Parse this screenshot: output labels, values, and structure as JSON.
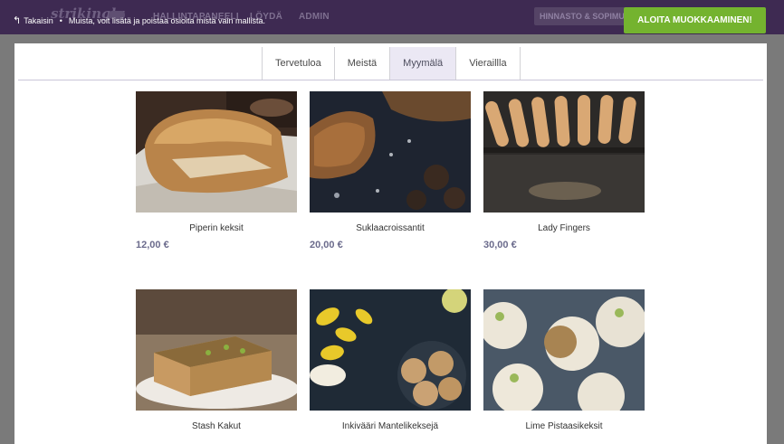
{
  "topbar": {
    "brand": "strikingly",
    "nav": [
      "HALLINTAPANEELI",
      "LÖYDÄ",
      "ADMIN"
    ],
    "back_label": "Takaisin",
    "notice": "Muista, voit lisätä ja poistaa osioita mistä vain mallista.",
    "pricing_label": "HINNASTO & SOPIMUKSET",
    "start_label": "ALOITA MUOKKAAMINEN!",
    "colors": {
      "bar": "#3e2a52",
      "accent": "#74b32f"
    }
  },
  "tabs": [
    "Tervetuloa",
    "Meistä",
    "Myymälä",
    "Vieraillla"
  ],
  "active_tab": "Myymälä",
  "products": [
    {
      "name": "Piperin keksit",
      "price": "12,00 €"
    },
    {
      "name": "Suklaacroissantit",
      "price": "20,00 €"
    },
    {
      "name": "Lady Fingers",
      "price": "30,00 €"
    },
    {
      "name": "Stash Kakut",
      "price": ""
    },
    {
      "name": "Inkivääri Mantelikeksejä",
      "price": ""
    },
    {
      "name": "Lime Pistaasikeksit",
      "price": ""
    }
  ]
}
